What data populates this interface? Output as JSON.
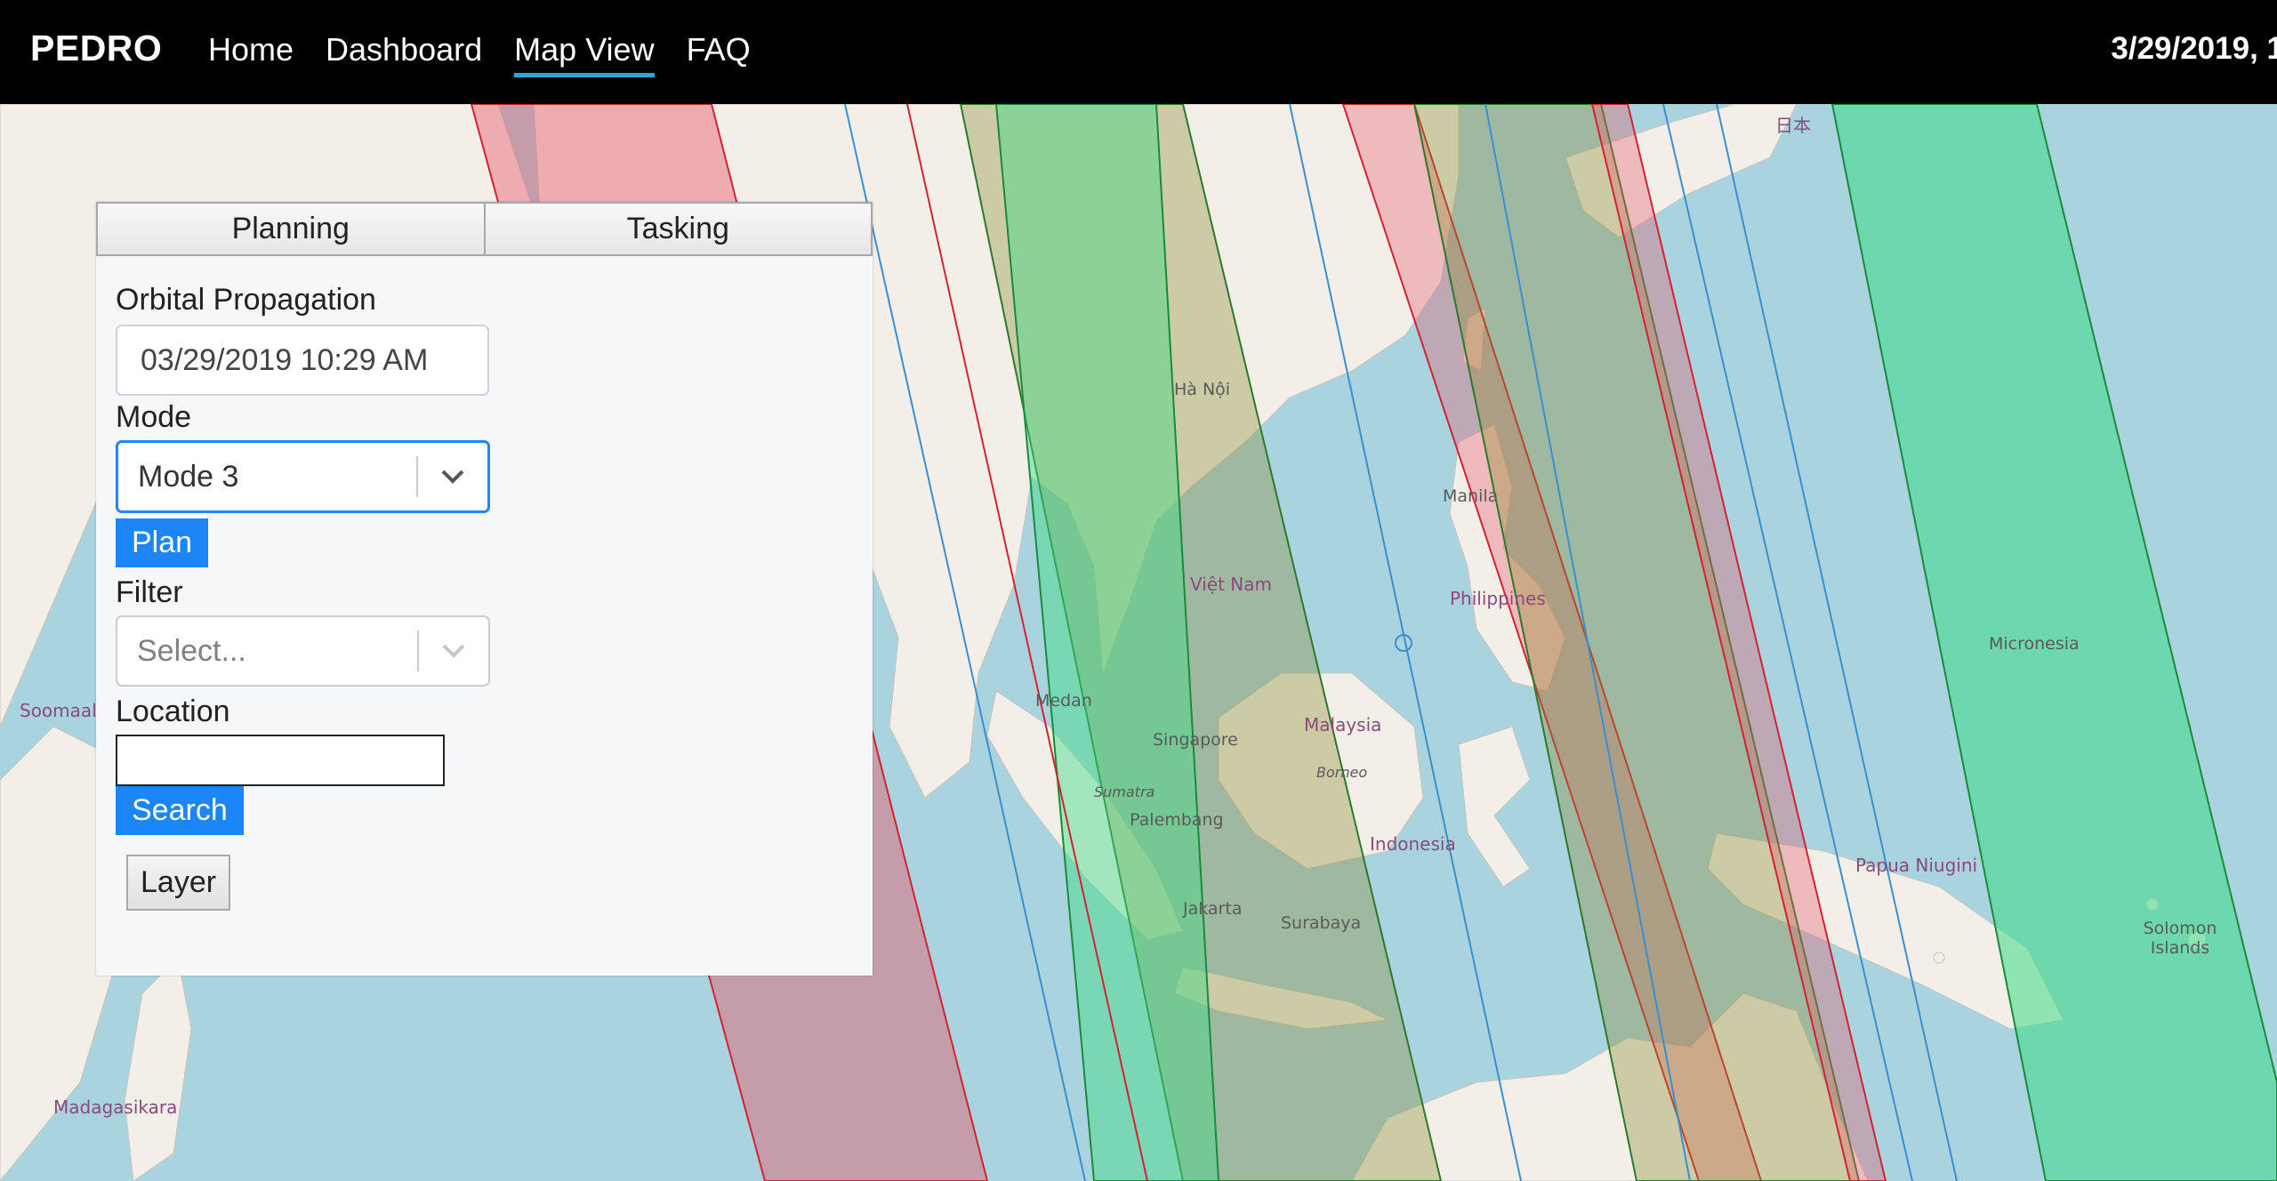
{
  "nav": {
    "brand": "PEDRO",
    "links": [
      "Home",
      "Dashboard",
      "Map View",
      "FAQ"
    ],
    "active": "Map View",
    "clock": "3/29/2019, 1"
  },
  "panel": {
    "tabs": [
      "Planning",
      "Tasking"
    ],
    "orbital_label": "Orbital Propagation",
    "datetime": "03/29/2019 10:29 AM",
    "mode_label": "Mode",
    "mode_value": "Mode 3",
    "plan_button": "Plan",
    "filter_label": "Filter",
    "filter_placeholder": "Select...",
    "location_label": "Location",
    "location_value": "",
    "search_button": "Search",
    "layer_button": "Layer"
  },
  "map": {
    "labels": {
      "vietnam": "Việt Nam",
      "philippines": "Philippines",
      "manila": "Manila",
      "malaysia": "Malaysia",
      "singapore": "Singapore",
      "medan": "Medan",
      "sumatra": "Sumatra",
      "palembang": "Palembang",
      "jakarta": "Jakarta",
      "surabaya": "Surabaya",
      "borneo": "Borneo",
      "indonesia": "Indonesia",
      "papua": "Papua Niugini",
      "micronesia": "Micronesia",
      "solomon": "Solomon Islands",
      "madagasikara": "Madagasikara",
      "somaal": "Soomaal",
      "hanoi": "Hà Nội",
      "japan": "日本"
    },
    "colors": {
      "land": "#f2efe9",
      "water": "#a9d3df",
      "green_swath": "#3ddc84",
      "red_swath": "#e75a6a",
      "blue_line": "#3a8fd0"
    }
  }
}
